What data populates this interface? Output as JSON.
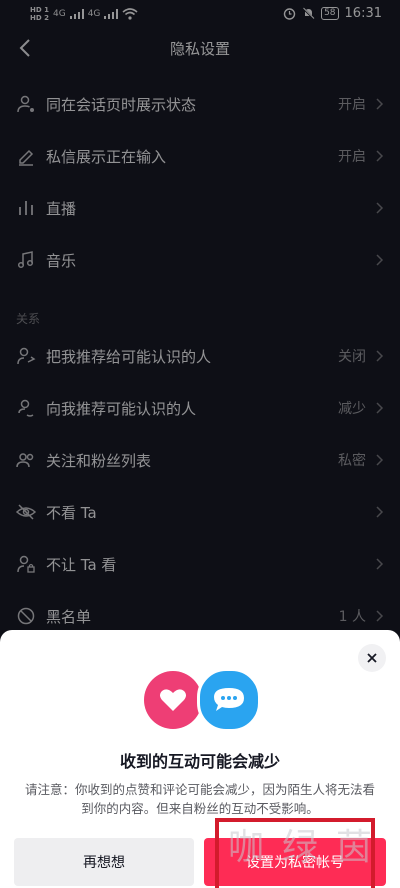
{
  "status_bar": {
    "sim1": "HD 1",
    "sim2": "HD 2",
    "net1": "4G",
    "net2": "4G",
    "battery": "58",
    "time": "16:31"
  },
  "header": {
    "title": "隐私设置"
  },
  "rows": [
    {
      "label": "同在会话页时展示状态",
      "value": "开启",
      "icon": "user-status-icon"
    },
    {
      "label": "私信展示正在输入",
      "value": "开启",
      "icon": "pencil-icon"
    },
    {
      "label": "直播",
      "value": "",
      "icon": "live-bars-icon"
    },
    {
      "label": "音乐",
      "value": "",
      "icon": "music-note-icon"
    },
    {
      "label": "把我推荐给可能认识的人",
      "value": "关闭",
      "icon": "share-user-icon"
    },
    {
      "label": "向我推荐可能认识的人",
      "value": "减少",
      "icon": "location-user-icon"
    },
    {
      "label": "关注和粉丝列表",
      "value": "私密",
      "icon": "users-icon"
    },
    {
      "label": "不看 Ta",
      "value": "",
      "icon": "eye-off-icon"
    },
    {
      "label": "不让 Ta 看",
      "value": "",
      "icon": "user-lock-icon"
    },
    {
      "label": "黑名单",
      "value": "1 人",
      "icon": "block-icon"
    }
  ],
  "section_relations": "关系",
  "dialog": {
    "title": "收到的互动可能会减少",
    "body": "请注意：你收到的点赞和评论可能会减少，因为陌生人将无法看到你的内容。但来自粉丝的互动不受影响。",
    "cancel": "再想想",
    "confirm": "设置为私密帐号"
  },
  "watermark": "咖绿茵",
  "colors": {
    "accent": "#fe2c55",
    "heart": "#ee3e75",
    "chat": "#2aa4f0",
    "bg": "#161823"
  }
}
